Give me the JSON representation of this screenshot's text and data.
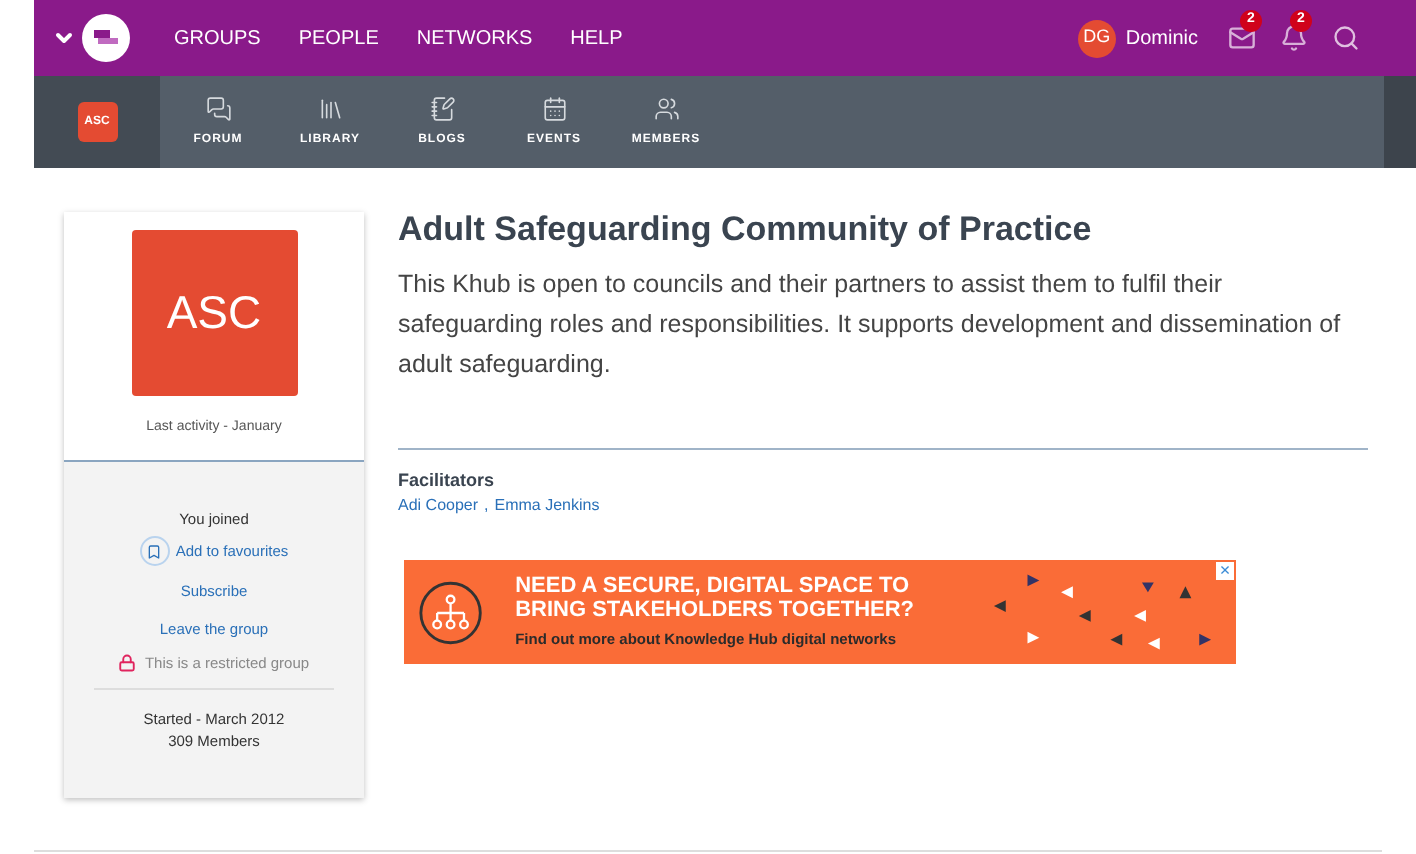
{
  "top_nav": {
    "links": [
      "GROUPS",
      "PEOPLE",
      "NETWORKS",
      "HELP"
    ],
    "user": {
      "initials": "DG",
      "name": "Dominic"
    },
    "messages_count": "2",
    "notifications_count": "2"
  },
  "group_nav": {
    "badge": "ASC",
    "items": [
      {
        "label": "FORUM",
        "kind": "forum"
      },
      {
        "label": "LIBRARY",
        "kind": "library"
      },
      {
        "label": "BLOGS",
        "kind": "blogs"
      },
      {
        "label": "EVENTS",
        "kind": "events"
      },
      {
        "label": "MEMBERS",
        "kind": "members"
      }
    ]
  },
  "sidebar": {
    "logo": "ASC",
    "last_activity": "Last activity - January",
    "status": "You joined",
    "favourite": "Add to favourites",
    "subscribe": "Subscribe",
    "leave": "Leave the group",
    "restricted": "This is a restricted group",
    "started": "Started - March 2012",
    "members": "309 Members"
  },
  "group": {
    "title": "Adult Safeguarding Community of Practice",
    "description": "This Khub is open to councils and their partners to assist them to fulfil their safeguarding roles and responsibilities. It supports development and dissemination of adult safeguarding.",
    "facilitators_heading": "Facilitators",
    "facilitators": [
      "Adi Cooper",
      "Emma Jenkins"
    ],
    "separator": ","
  },
  "banner": {
    "headline": "NEED A SECURE, DIGITAL SPACE TO BRING STAKEHOLDERS TOGETHER?",
    "subline": "Find out more about Knowledge Hub digital networks",
    "close": "×"
  }
}
